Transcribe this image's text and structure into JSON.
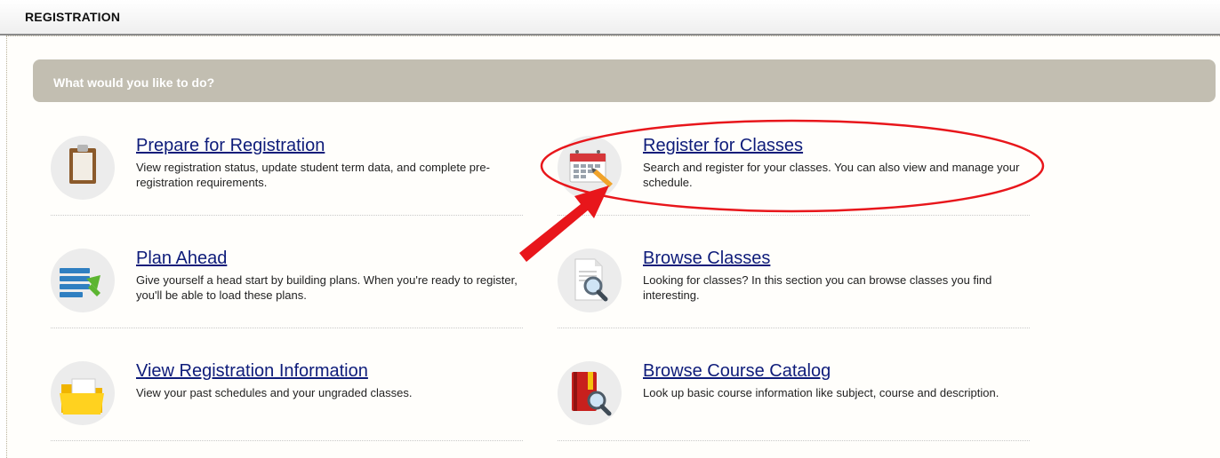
{
  "header": {
    "title": "REGISTRATION"
  },
  "banner": {
    "text": "What would you like to do?"
  },
  "items": [
    {
      "title": "Prepare for Registration",
      "description": "View registration status, update student term data, and complete pre-registration requirements.",
      "icon": "clipboard-icon"
    },
    {
      "title": "Register for Classes",
      "description": "Search and register for your classes. You can also view and manage your schedule.",
      "icon": "calendar-pencil-icon"
    },
    {
      "title": "Plan Ahead",
      "description": "Give yourself a head start by building plans. When you're ready to register, you'll be able to load these plans.",
      "icon": "plan-list-icon"
    },
    {
      "title": "Browse Classes",
      "description": "Looking for classes? In this section you can browse classes you find interesting.",
      "icon": "document-search-icon"
    },
    {
      "title": "View Registration Information",
      "description": "View your past schedules and your ungraded classes.",
      "icon": "folder-icon"
    },
    {
      "title": "Browse Course Catalog",
      "description": "Look up basic course information like subject, course and description.",
      "icon": "book-search-icon"
    }
  ],
  "colors": {
    "banner": "#c2beb1",
    "link": "#0e1c7a",
    "annotation": "#e8161b"
  }
}
